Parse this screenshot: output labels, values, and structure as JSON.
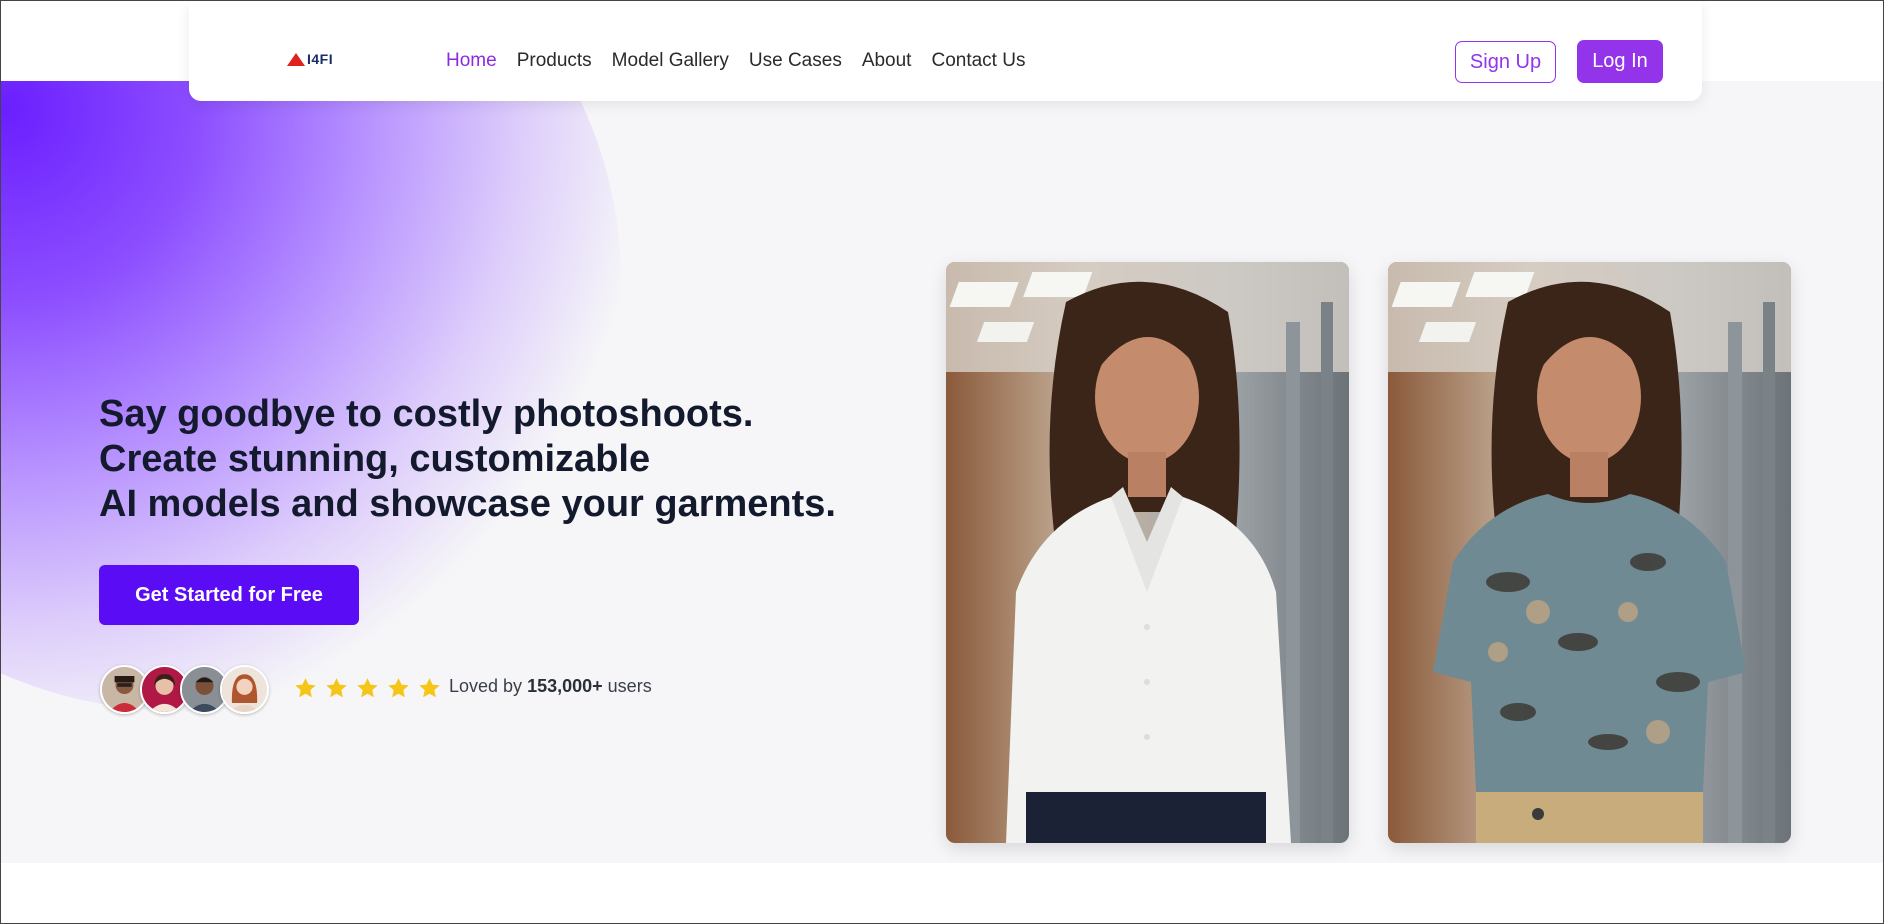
{
  "nav": {
    "logo_text": "I4FI",
    "items": [
      {
        "label": "Home",
        "active": true
      },
      {
        "label": "Products",
        "active": false
      },
      {
        "label": "Model Gallery",
        "active": false
      },
      {
        "label": "Use Cases",
        "active": false
      },
      {
        "label": "About",
        "active": false
      },
      {
        "label": "Contact Us",
        "active": false
      }
    ],
    "signup_label": "Sign Up",
    "login_label": "Log In"
  },
  "hero": {
    "headline_lines": [
      "Say goodbye to costly photoshoots.",
      "Create stunning, customizable",
      "AI models and showcase your garments."
    ],
    "cta_label": "Get Started for Free",
    "rating_stars": 5,
    "loved_prefix": "Loved by",
    "loved_count": "153,000+",
    "loved_suffix": "users"
  },
  "colors": {
    "accent": "#9333ea",
    "cta": "#5a0cf5",
    "star": "#f5c518",
    "logo_red": "#e0221f",
    "logo_navy": "#1a2d6b"
  },
  "icons": [
    "star-icon",
    "logo-icon"
  ]
}
